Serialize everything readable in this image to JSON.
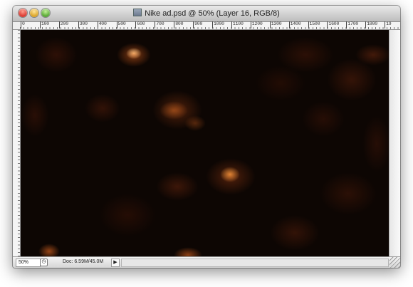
{
  "window": {
    "title": "Nike ad.psd @ 50% (Layer 16, RGB/8)"
  },
  "ruler": {
    "top_ticks": [
      "0",
      "100",
      "200",
      "300",
      "400",
      "500",
      "600",
      "700",
      "800",
      "900",
      "1000",
      "1100",
      "1200",
      "1300",
      "1400",
      "1500",
      "1600",
      "1700",
      "1800",
      "19"
    ]
  },
  "status": {
    "zoom": "50%",
    "doc_info": "Doc: 6.59M/45.0M",
    "arrow": "▶"
  },
  "icons": {
    "close": "close-icon",
    "minimize": "minimize-icon",
    "maximize": "maximize-icon",
    "document": "document-icon"
  },
  "colors": {
    "canvas_bg": "#0d0603",
    "glow_core": "#ffe08a",
    "glow_orange": "#e0601a",
    "glow_dark": "#5a1c08"
  }
}
